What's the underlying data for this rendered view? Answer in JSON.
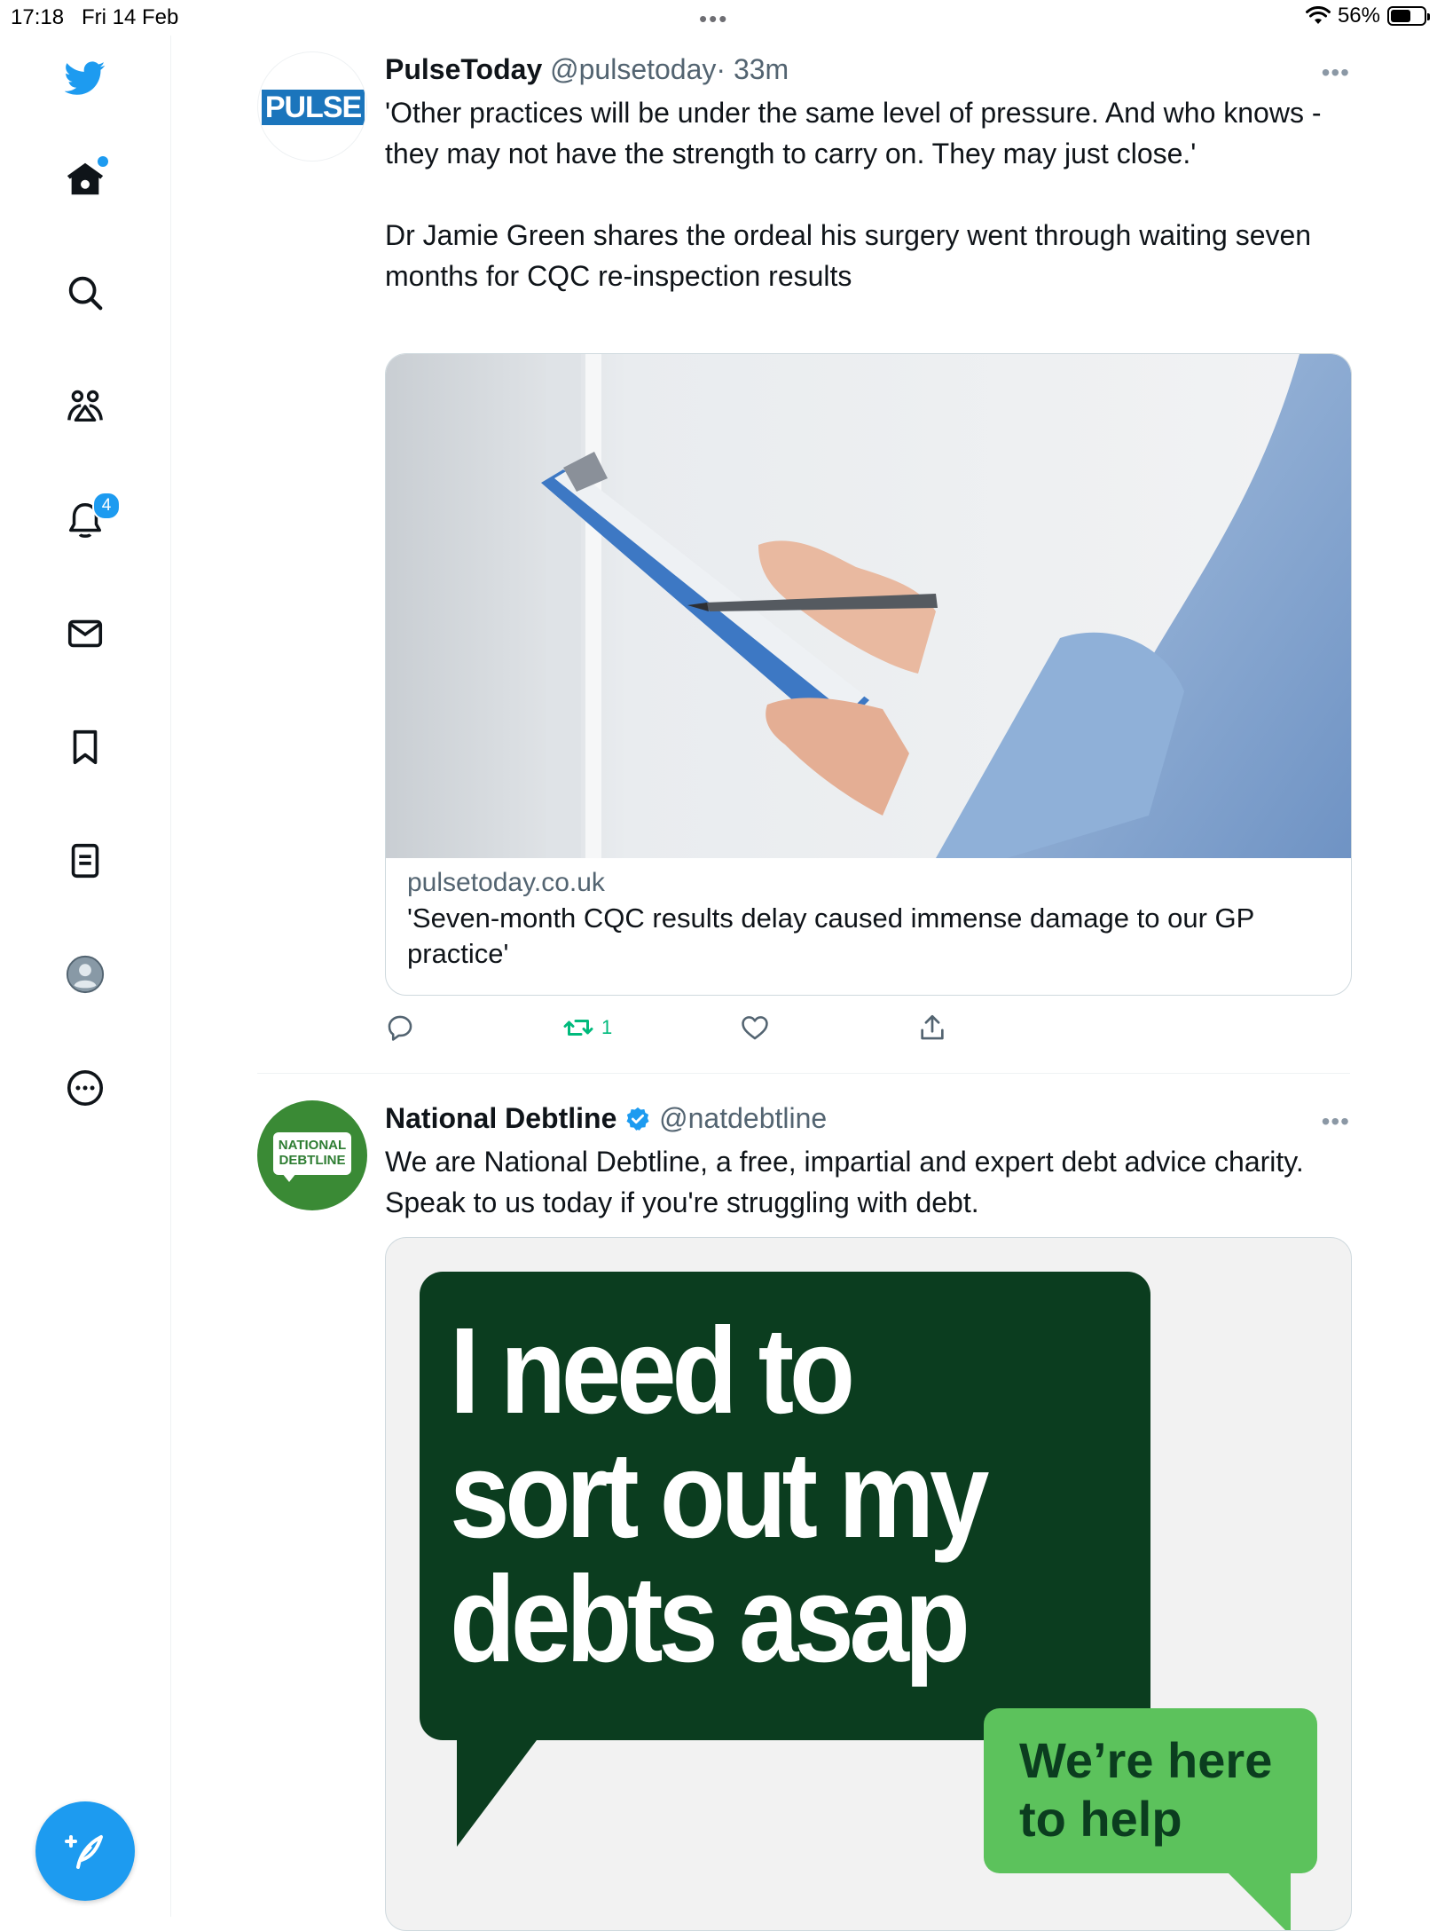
{
  "status_bar": {
    "time": "17:18",
    "date": "Fri 14 Feb",
    "battery": "56%"
  },
  "sidebar": {
    "items": [
      {
        "icon": "twitter-logo-icon"
      },
      {
        "icon": "home-icon"
      },
      {
        "icon": "search-icon"
      },
      {
        "icon": "communities-icon"
      },
      {
        "icon": "bell-icon"
      },
      {
        "icon": "mail-icon"
      },
      {
        "icon": "bookmark-icon"
      },
      {
        "icon": "lists-icon"
      },
      {
        "icon": "profile-avatar-icon"
      },
      {
        "icon": "more-circle-icon"
      }
    ],
    "notifications_count": "4"
  },
  "colors": {
    "accent": "#1d9bf0",
    "retweet_green": "#00ba7c",
    "debtline_dark_green": "#0b3d1f",
    "debtline_light_green": "#5cc25c"
  },
  "tweets": [
    {
      "name": "PulseToday",
      "handle": "@pulsetoday",
      "time": "· 33m",
      "avatar_text": "PULSE",
      "text": "'Other practices will be under the same level of pressure. And who knows - they may not have the strength to carry on. They may just close.'\n\nDr Jamie Green shares the ordeal his surgery went through waiting seven months for CQC re-inspection results",
      "card": {
        "domain": "pulsetoday.co.uk",
        "title": "'Seven-month CQC results delay caused immense damage to our GP practice'"
      },
      "retweet_count": "1"
    },
    {
      "name": "National Debtline",
      "handle": "@natdebtline",
      "verified": true,
      "avatar_text_line1": "NATIONAL",
      "avatar_text_line2": "DEBTLINE",
      "text": "We are National Debtline, a free, impartial and expert debt advice charity. Speak to us today if you're struggling with debt.",
      "image": {
        "headline_line1": "I need to",
        "headline_line2": "sort out my",
        "headline_line3": "debts asap",
        "bubble_line1": "We’re here",
        "bubble_line2": "to help"
      }
    }
  ]
}
